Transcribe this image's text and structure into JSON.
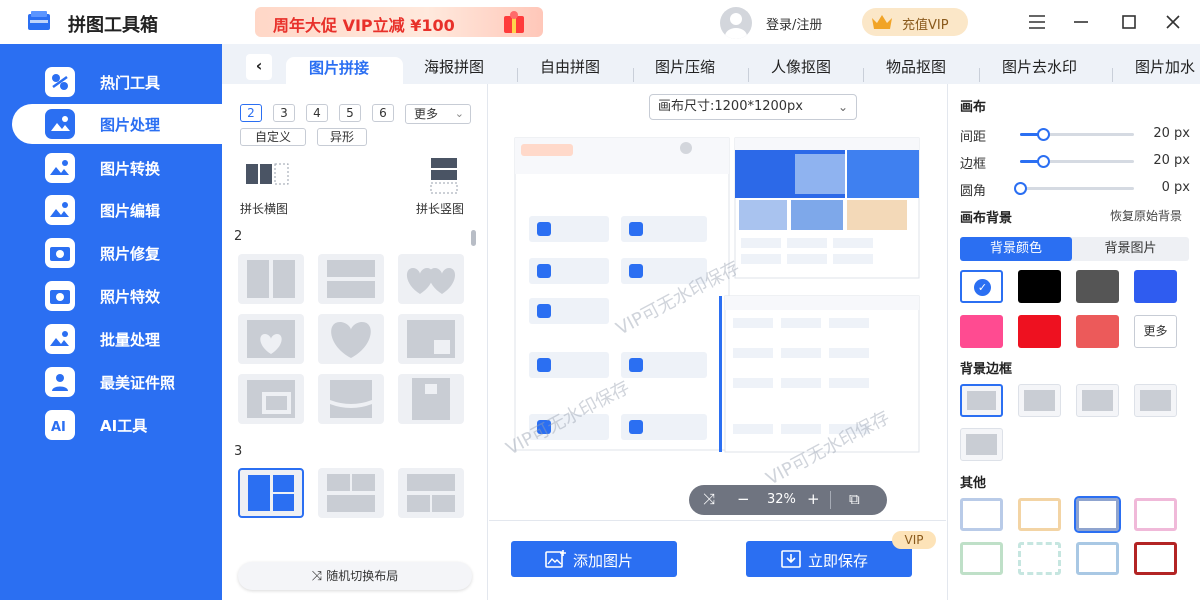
{
  "app": {
    "title": "拼图工具箱"
  },
  "promo": {
    "text": "周年大促 VIP立减 ¥100"
  },
  "user": {
    "login_label": "登录/注册"
  },
  "vip_button": {
    "label": "充值VIP"
  },
  "sidebar": {
    "items": [
      {
        "label": "热门工具",
        "icon": "hot-tools-icon"
      },
      {
        "label": "图片处理",
        "icon": "image-process-icon"
      },
      {
        "label": "图片转换",
        "icon": "image-convert-icon"
      },
      {
        "label": "图片编辑",
        "icon": "image-edit-icon"
      },
      {
        "label": "照片修复",
        "icon": "photo-repair-icon"
      },
      {
        "label": "照片特效",
        "icon": "photo-effects-icon"
      },
      {
        "label": "批量处理",
        "icon": "batch-process-icon"
      },
      {
        "label": "最美证件照",
        "icon": "id-photo-icon"
      },
      {
        "label": "AI工具",
        "icon": "ai-tools-icon"
      }
    ]
  },
  "tabs": {
    "items": [
      {
        "label": "图片拼接"
      },
      {
        "label": "海报拼图"
      },
      {
        "label": "自由拼图"
      },
      {
        "label": "图片压缩"
      },
      {
        "label": "人像抠图"
      },
      {
        "label": "物品抠图"
      },
      {
        "label": "图片去水印"
      },
      {
        "label": "图片加水"
      }
    ]
  },
  "layout_panel": {
    "counts": [
      "2",
      "3",
      "4",
      "5",
      "6"
    ],
    "more_label": "更多",
    "custom_label": "自定义",
    "irregular_label": "异形",
    "long_horizontal_label": "拼长横图",
    "long_vertical_label": "拼长竖图",
    "section_2": "2",
    "section_3": "3",
    "random_label": "随机切换布局"
  },
  "canvas": {
    "size_label": "画布尺寸:1200*1200px",
    "zoom": "32%",
    "watermark": "VIP可无水印保存"
  },
  "actions": {
    "add_label": "添加图片",
    "save_label": "立即保存",
    "vip_tag": "VIP"
  },
  "settings": {
    "canvas_heading": "画布",
    "sliders": [
      {
        "label": "间距",
        "value": "20 px",
        "level": 0.2
      },
      {
        "label": "边框",
        "value": "20 px",
        "level": 0.2
      },
      {
        "label": "圆角",
        "value": "0 px",
        "level": 0
      }
    ],
    "bg_heading": "画布背景",
    "restore_label": "恢复原始背景",
    "bg_tab_color": "背景颜色",
    "bg_tab_image": "背景图片",
    "colors": [
      "#ffffff",
      "#000000",
      "#555555",
      "#2f5cf0",
      "#ff4b91",
      "#ee1120",
      "#ec5a5a"
    ],
    "more_colors_label": "更多",
    "border_heading": "背景边框",
    "other_heading": "其他"
  }
}
